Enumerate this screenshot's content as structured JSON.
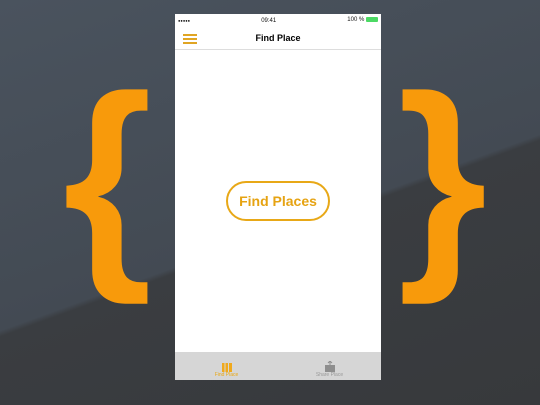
{
  "status": {
    "signal": "●●●●●",
    "time": "09:41",
    "battery": "100 %"
  },
  "nav": {
    "title": "Find Place"
  },
  "main": {
    "button_label": "Find Places"
  },
  "tabs": [
    {
      "label": "Find Place",
      "icon": "map-icon",
      "active": true
    },
    {
      "label": "Share Place",
      "icon": "share-icon",
      "active": false
    }
  ],
  "decor": {
    "left": "{",
    "right": "}",
    "color": "#f89a0b"
  },
  "colors": {
    "accent": "#e8a817"
  }
}
